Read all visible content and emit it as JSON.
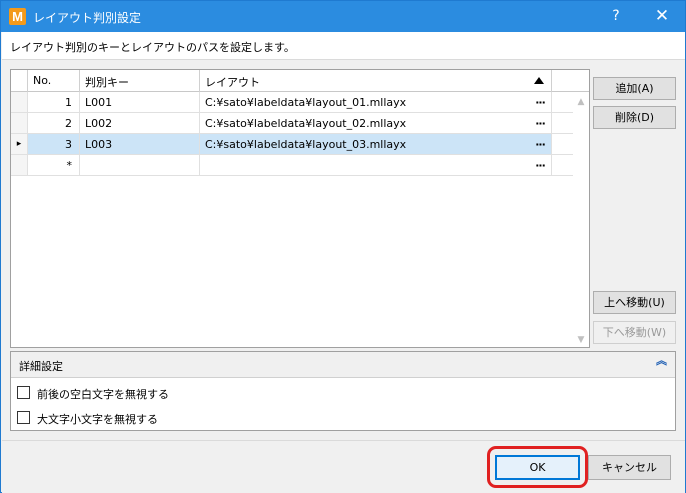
{
  "window": {
    "icon_letter": "M",
    "title": "レイアウト判別設定",
    "help_label": "?",
    "close_label": "✕",
    "description": "レイアウト判別のキーとレイアウトのパスを設定します。"
  },
  "grid": {
    "columns": {
      "no": "No.",
      "key": "判別キー",
      "layout": "レイアウト"
    },
    "sorted_column": "layout",
    "sort_direction": "ascending",
    "rows": [
      {
        "no": "1",
        "key": "L001",
        "layout": "C:¥sato¥labeldata¥layout_01.mllayx",
        "dots": "···"
      },
      {
        "no": "2",
        "key": "L002",
        "layout": "C:¥sato¥labeldata¥layout_02.mllayx",
        "dots": "···"
      },
      {
        "no": "3",
        "key": "L003",
        "layout": "C:¥sato¥labeldata¥layout_03.mllayx",
        "dots": "···",
        "current": "▸"
      },
      {
        "no": "*",
        "key": "",
        "layout": "",
        "dots": "···"
      }
    ]
  },
  "buttons": {
    "add": "追加(A)",
    "delete": "削除(D)",
    "move_up": "上へ移動(U)",
    "move_down": "下へ移動(W)",
    "ok": "OK",
    "cancel": "キャンセル"
  },
  "details": {
    "title": "詳細設定",
    "collapse_glyph": "︽",
    "options": [
      {
        "label": "前後の空白文字を無視する",
        "checked": false
      },
      {
        "label": "大文字小文字を無視する",
        "checked": false
      }
    ]
  },
  "colors": {
    "titlebar": "#2b8ce0",
    "selection": "#cce4f7",
    "highlight": "#e02020"
  }
}
